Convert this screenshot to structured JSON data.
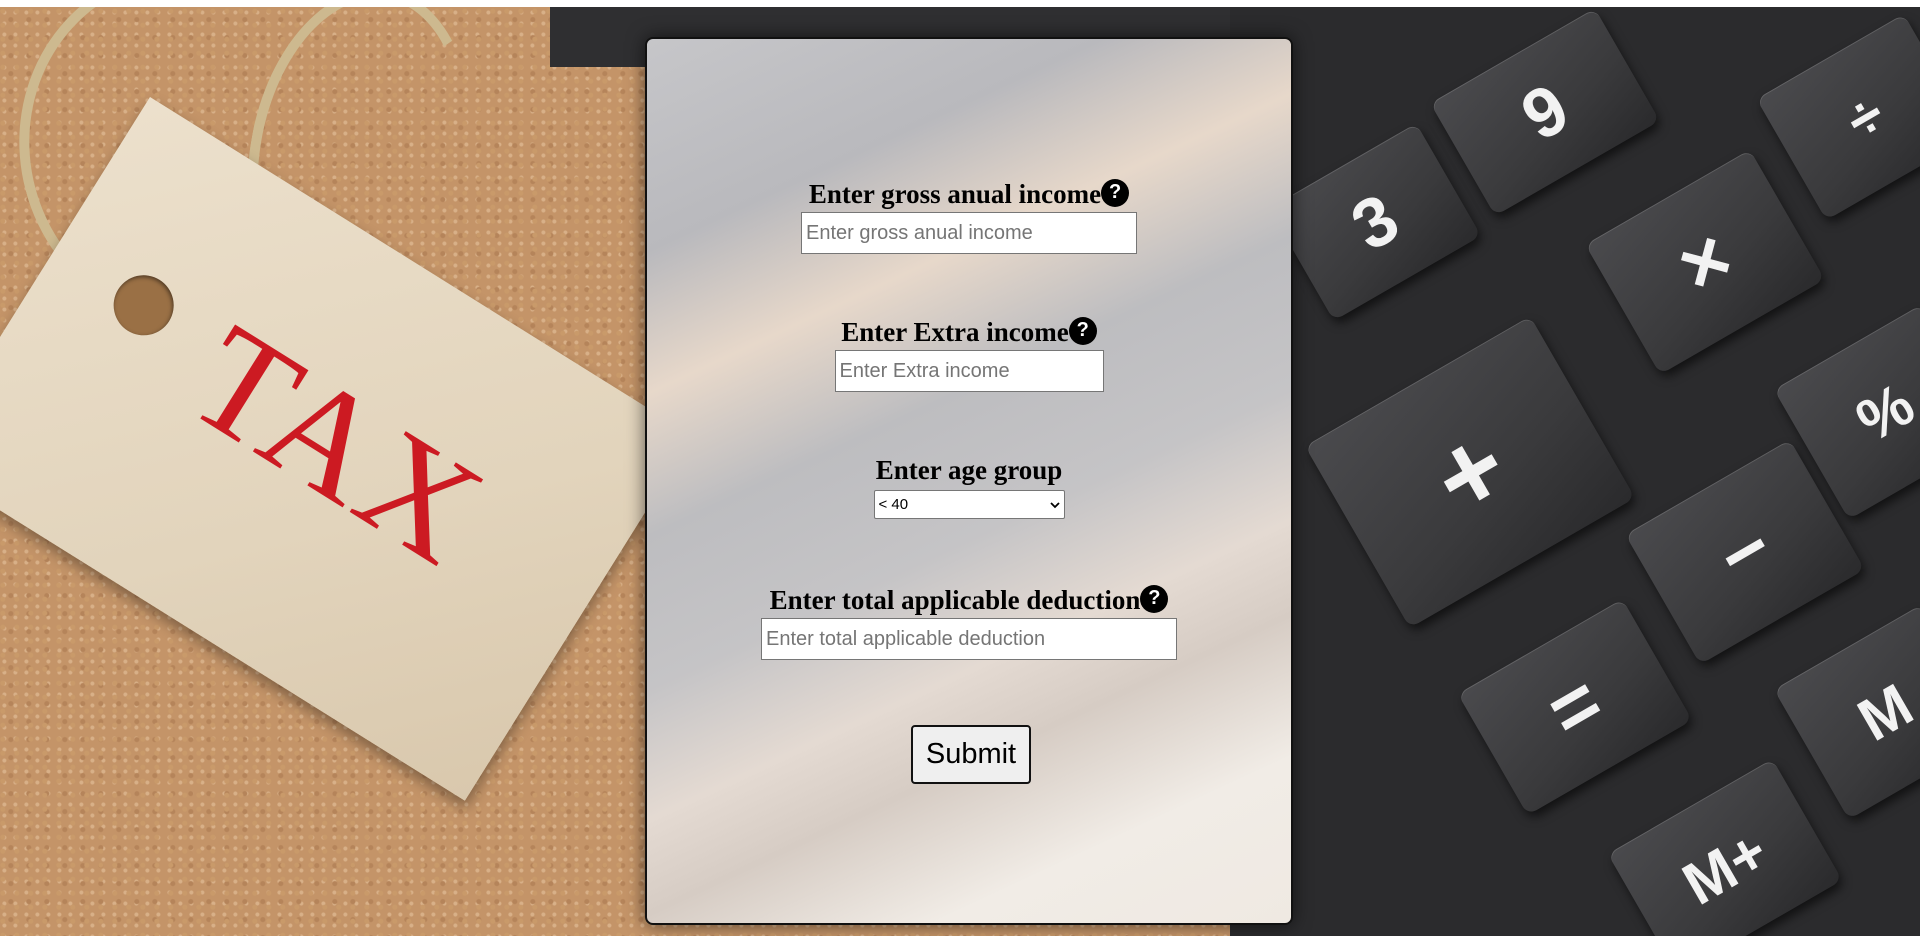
{
  "form": {
    "gross_income": {
      "label": "Enter gross anual income",
      "placeholder": "Enter gross anual income",
      "value": "",
      "help_icon": "question-circle-icon"
    },
    "extra_income": {
      "label": "Enter Extra income",
      "placeholder": "Enter Extra income",
      "value": "",
      "help_icon": "question-circle-icon"
    },
    "age_group": {
      "label": "Enter age group",
      "selected": "< 40",
      "options": [
        "< 40"
      ]
    },
    "deduction": {
      "label": "Enter total applicable deduction",
      "placeholder": "Enter total applicable deduction",
      "value": "",
      "help_icon": "question-circle-icon"
    },
    "submit_label": "Submit"
  },
  "background": {
    "tag_text": "TAX",
    "keys": [
      "9",
      "3",
      "×",
      "+",
      "−",
      "=",
      "÷",
      "%",
      "M",
      "M+"
    ]
  },
  "help_glyph": "?"
}
